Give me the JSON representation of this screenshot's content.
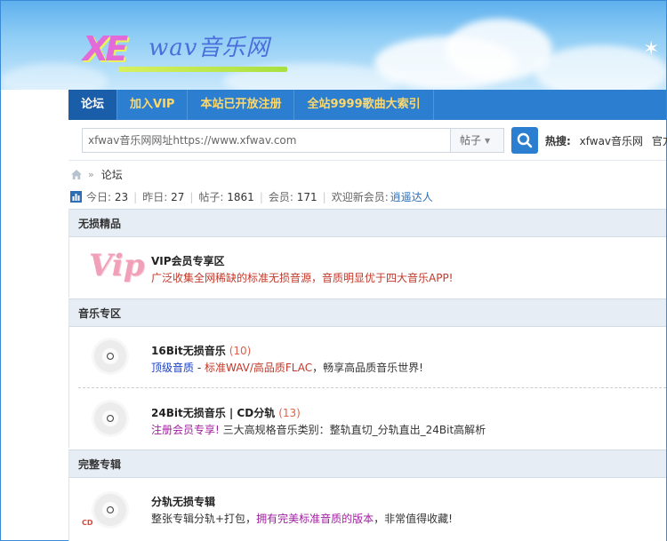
{
  "logo": {
    "mark": "XE",
    "text": "wav音乐网"
  },
  "nav": [
    {
      "label": "论坛",
      "active": true
    },
    {
      "label": "加入VIP",
      "active": false
    },
    {
      "label": "本站已开放注册",
      "active": false
    },
    {
      "label": "全站9999歌曲大索引",
      "active": false
    }
  ],
  "search": {
    "value": "xfwav音乐网网址https://www.xfwav.com",
    "type": "帖子",
    "hot_label": "热搜:",
    "hot_links": [
      "xfwav音乐网",
      "官方"
    ]
  },
  "breadcrumb": {
    "current": "论坛"
  },
  "stats": {
    "today_label": "今日:",
    "today": "23",
    "yesterday_label": "昨日:",
    "yesterday": "27",
    "posts_label": "帖子:",
    "posts": "1861",
    "members_label": "会员:",
    "members": "171",
    "welcome_label": "欢迎新会员:",
    "new_member": "逍遥达人"
  },
  "sections": [
    {
      "title": "无损精品",
      "forums": [
        {
          "title": "VIP会员专享区",
          "count": "",
          "icon": "vip-icon",
          "icon_text": "Vip",
          "desc_parts": [
            {
              "text": "广泛收集全网稀缺的标准无损音源，音质明显优于四大音乐APP!",
              "color": "#c0392b"
            }
          ]
        }
      ]
    },
    {
      "title": "音乐专区",
      "forums": [
        {
          "title": "16Bit无损音乐",
          "count": "(10)",
          "icon": "cd-disc-icon",
          "desc_parts": [
            {
              "text": "顶级音质",
              "color": "#1a3fc4"
            },
            {
              "text": " - ",
              "color": "#333333"
            },
            {
              "text": "标准WAV/高品质FLAC",
              "color": "#c0392b"
            },
            {
              "text": "，畅享高品质音乐世界!",
              "color": "#333333"
            }
          ]
        },
        {
          "title": "24Bit无损音乐 | CD分轨",
          "count": "(13)",
          "icon": "cd-disc-icon",
          "desc_parts": [
            {
              "text": "注册会员专享!",
              "color": "#a020a0"
            },
            {
              "text": " 三大高规格音乐类别：整轨直切_分轨直出_24Bit高解析",
              "color": "#333333"
            }
          ]
        }
      ]
    },
    {
      "title": "完整专辑",
      "forums": [
        {
          "title": "分轨无损专辑",
          "count": "",
          "icon": "cd-album-icon",
          "icon_text": "CD",
          "desc_parts": [
            {
              "text": "整张专辑分轨+打包，",
              "color": "#333333"
            },
            {
              "text": "拥有完美标准音质的版本",
              "color": "#a020a0"
            },
            {
              "text": "，非常值得收藏!",
              "color": "#333333"
            }
          ]
        }
      ]
    }
  ]
}
